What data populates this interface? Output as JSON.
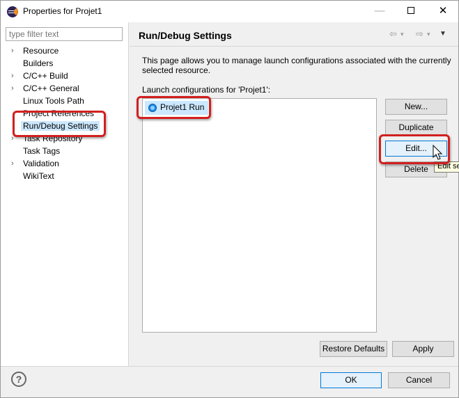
{
  "window": {
    "title": "Properties for Projet1",
    "controls": {
      "minimize": "—",
      "close": "✕"
    }
  },
  "left": {
    "filter_placeholder": "type filter text",
    "tree": [
      {
        "label": "Resource",
        "expandable": true,
        "selected": false
      },
      {
        "label": "Builders",
        "expandable": false,
        "selected": false
      },
      {
        "label": "C/C++ Build",
        "expandable": true,
        "selected": false
      },
      {
        "label": "C/C++ General",
        "expandable": true,
        "selected": false
      },
      {
        "label": "Linux Tools Path",
        "expandable": false,
        "selected": false
      },
      {
        "label": "Project References",
        "expandable": false,
        "selected": false
      },
      {
        "label": "Run/Debug Settings",
        "expandable": false,
        "selected": true
      },
      {
        "label": "Task Repository",
        "expandable": true,
        "selected": false
      },
      {
        "label": "Task Tags",
        "expandable": false,
        "selected": false
      },
      {
        "label": "Validation",
        "expandable": true,
        "selected": false
      },
      {
        "label": "WikiText",
        "expandable": false,
        "selected": false
      }
    ],
    "chevron_glyph": "›"
  },
  "right": {
    "page_title": "Run/Debug Settings",
    "description": "This page allows you to manage launch configurations associated with the currently selected resource.",
    "list_label": "Launch configurations for 'Projet1':",
    "configs": [
      "Projet1 Run"
    ],
    "buttons": {
      "new": "New...",
      "duplicate": "Duplicate",
      "edit": "Edit...",
      "delete": "Delete",
      "restore_defaults": "Restore Defaults",
      "apply": "Apply"
    },
    "tooltip": "Edit se"
  },
  "bottom": {
    "help": "?",
    "ok": "OK",
    "cancel": "Cancel"
  },
  "colors": {
    "selection": "#cce8ff",
    "highlight": "#d21f1f",
    "focus": "#0078d7"
  }
}
